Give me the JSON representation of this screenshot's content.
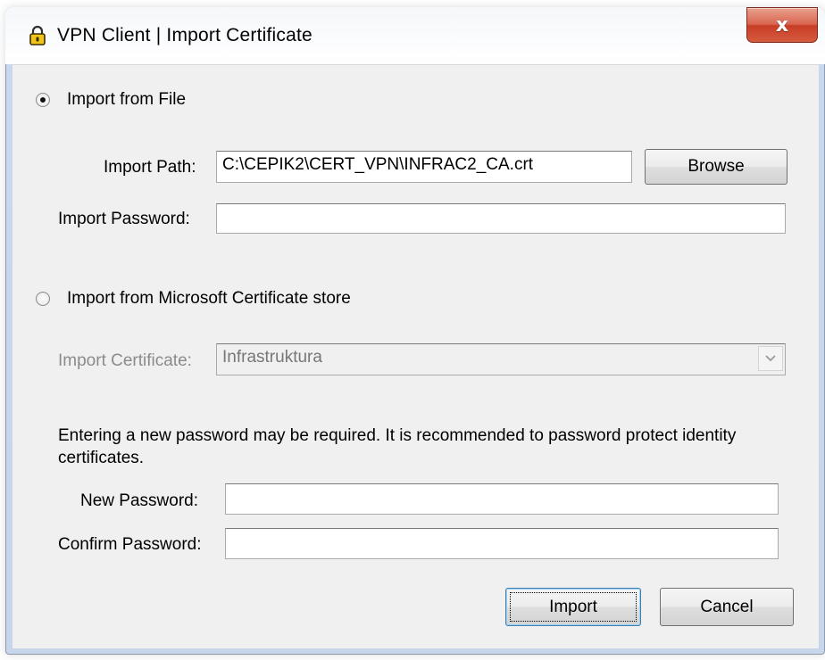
{
  "window": {
    "title": "VPN Client  |  Import Certificate",
    "close_label": "x"
  },
  "file_section": {
    "radio_label": "Import from File",
    "selected": true,
    "import_path_label": "Import Path:",
    "import_path_value": "C:\\CEPIK2\\CERT_VPN\\INFRAC2_CA.crt",
    "browse_label": "Browse",
    "import_password_label": "Import Password:",
    "import_password_value": ""
  },
  "store_section": {
    "radio_label": "Import from Microsoft Certificate store",
    "selected": false,
    "import_certificate_label": "Import Certificate:",
    "import_certificate_value": "Infrastruktura"
  },
  "password_section": {
    "description": "Entering a new password may be required.  It is recommended to password protect identity certificates.",
    "new_password_label": "New Password:",
    "new_password_value": "",
    "confirm_password_label": "Confirm Password:",
    "confirm_password_value": ""
  },
  "actions": {
    "import_label": "Import",
    "cancel_label": "Cancel"
  },
  "icons": {
    "title_icon": "lock-icon",
    "close_icon": "close-icon",
    "dropdown_icon": "chevron-down-icon"
  },
  "colors": {
    "dialog_background": "#f0f0f0",
    "close_button": "#c73d25",
    "disabled_text": "#8b8b8b"
  }
}
